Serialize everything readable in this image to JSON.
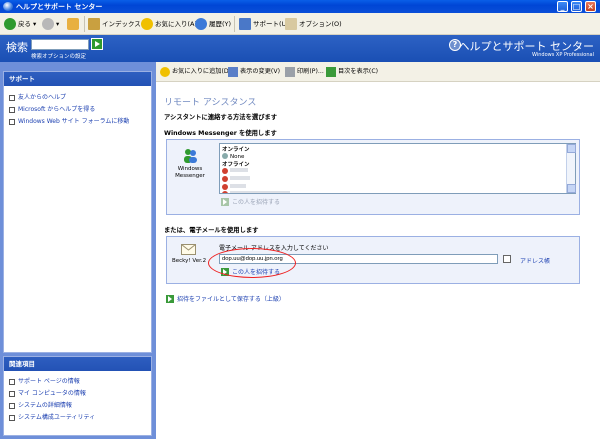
{
  "window": {
    "title": "ヘルプとサポート センター"
  },
  "toolbar": {
    "back": "戻る",
    "index": "インデックス(N)",
    "favorites": "お気に入り(A)",
    "history": "履歴(Y)",
    "support": "サポート(U)",
    "options": "オプション(O)"
  },
  "header": {
    "search_label": "検索",
    "search_value": "",
    "search_options": "検索オプションの設定",
    "brand_title": "ヘルプとサポート センター",
    "brand_sub": "Windows XP Professional"
  },
  "sidebar": {
    "support_title": "サポート",
    "support_items": [
      "友人からのヘルプ",
      "Microsoft からヘルプを得る",
      "Windows Web サイト フォーラムに移動"
    ],
    "related_title": "関連項目",
    "related_items": [
      "サポート ページの情報",
      "マイ コンピュータの情報",
      "システムの詳細情報",
      "システム構成ユーティリティ"
    ]
  },
  "content_toolbar": {
    "add_favorites": "お気に入りに追加(D)",
    "change_view": "表示の変更(V)",
    "print": "印刷(P)...",
    "show_index": "目次を表示(C)"
  },
  "main": {
    "page_title": "リモート アシスタンス",
    "choose_method": "アシスタントに連絡する方法を選びます",
    "messenger_heading": "Windows Messenger を使用します",
    "messenger_label_1": "Windows",
    "messenger_label_2": "Messenger",
    "contacts": {
      "online_group": "オンライン",
      "online_item": "None",
      "offline_group": "オフライン"
    },
    "invite_messenger": "この人を招待する",
    "email_heading": "または、電子メールを使用します",
    "email_client": "Becky! Ver.2",
    "email_prompt": "電子メール アドレスを入力してください",
    "email_value": "dop.uu@dop.uu.jpn.org",
    "address_book": "アドレス帳",
    "invite_email": "この人を招待する",
    "save_invite": "招待をファイルとして保存する（上級）"
  }
}
